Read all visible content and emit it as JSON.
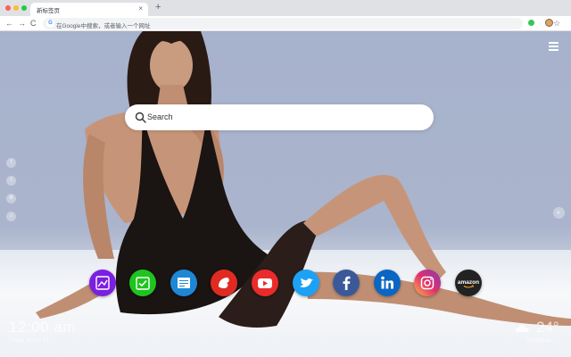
{
  "browser": {
    "tab_title": "新标签页",
    "tab_close": "×",
    "new_tab": "+",
    "back": "←",
    "forward": "→",
    "reload": "C",
    "address_placeholder": "在Google中搜索，或者输入一个网址",
    "google_icon_letter": "G",
    "star": "☆",
    "menu": "⋮"
  },
  "newtab": {
    "search_placeholder": "Search",
    "side_icons": [
      {
        "icon": "facebook-icon",
        "glyph": "f"
      },
      {
        "icon": "twitter-icon",
        "glyph": "t"
      },
      {
        "icon": "settings-icon",
        "glyph": "⚙"
      },
      {
        "icon": "search-icon",
        "glyph": "⌕"
      }
    ],
    "bg_switch_glyph": "◐",
    "time": "12:00 am",
    "date": "Friday, March 15",
    "temperature": "24°",
    "location": "Sunnyvale"
  },
  "apps": [
    {
      "name": "Image tool",
      "icon": "image-icon",
      "color": "#7b1fe0"
    },
    {
      "name": "Tasks",
      "icon": "checkmark-icon",
      "color": "#1fc41f"
    },
    {
      "name": "Notes",
      "icon": "note-icon",
      "color": "#1e87d6"
    },
    {
      "name": "Games",
      "icon": "gamepad-icon",
      "color": "#e02b22"
    },
    {
      "name": "YouTube",
      "icon": "youtube-icon",
      "color": "#ea2b2b"
    },
    {
      "name": "Twitter",
      "icon": "twitter-icon",
      "color": "#1da1f2"
    },
    {
      "name": "Facebook",
      "icon": "facebook-icon",
      "color": "#3b5998"
    },
    {
      "name": "LinkedIn",
      "icon": "linkedin-icon",
      "color": "#0a66c2"
    },
    {
      "name": "Instagram",
      "icon": "instagram-icon",
      "color": "#c13584"
    },
    {
      "name": "Amazon",
      "icon": "amazon-icon",
      "color": "#222222",
      "label": "amazon"
    }
  ]
}
